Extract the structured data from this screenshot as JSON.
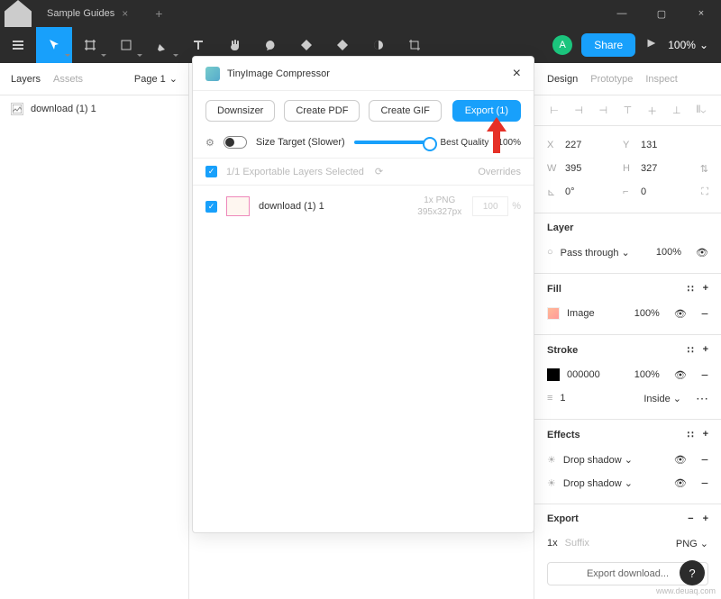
{
  "titlebar": {
    "tab": "Sample Guides"
  },
  "toolbar": {
    "avatar_initial": "A",
    "share_label": "Share",
    "zoom": "100%"
  },
  "leftpanel": {
    "tab_layers": "Layers",
    "tab_assets": "Assets",
    "page_label": "Page 1",
    "layer_name": "download (1) 1"
  },
  "modal": {
    "title": "TinyImage Compressor",
    "btn_downsizer": "Downsizer",
    "btn_createpdf": "Create PDF",
    "btn_creategif": "Create GIF",
    "btn_export": "Export (1)",
    "size_target_label": "Size Target (Slower)",
    "best_quality": "Best Quality",
    "best_quality_pct": "100%",
    "selected_label": "1/1 Exportable Layers Selected",
    "overrides": "Overrides",
    "item_name": "download (1) 1",
    "item_meta_line1": "1x PNG",
    "item_meta_line2": "395x327px",
    "item_pct": "100",
    "item_pct_sign": "%"
  },
  "rightpanel": {
    "tab_design": "Design",
    "tab_prototype": "Prototype",
    "tab_inspect": "Inspect",
    "x_lbl": "X",
    "x_val": "227",
    "y_lbl": "Y",
    "y_val": "131",
    "w_lbl": "W",
    "w_val": "395",
    "h_lbl": "H",
    "h_val": "327",
    "rot_val": "0°",
    "corner_val": "0",
    "layer": {
      "title": "Layer",
      "mode": "Pass through",
      "opacity": "100%"
    },
    "fill": {
      "title": "Fill",
      "type": "Image",
      "opacity": "100%"
    },
    "stroke": {
      "title": "Stroke",
      "hex": "000000",
      "opacity": "100%",
      "width": "1",
      "style": "Inside"
    },
    "effects": {
      "title": "Effects",
      "type": "Drop shadow"
    },
    "export": {
      "title": "Export",
      "scale": "1x",
      "suffix": "Suffix",
      "format": "PNG",
      "button": "Export download..."
    }
  },
  "watermark": "www.deuaq.com"
}
